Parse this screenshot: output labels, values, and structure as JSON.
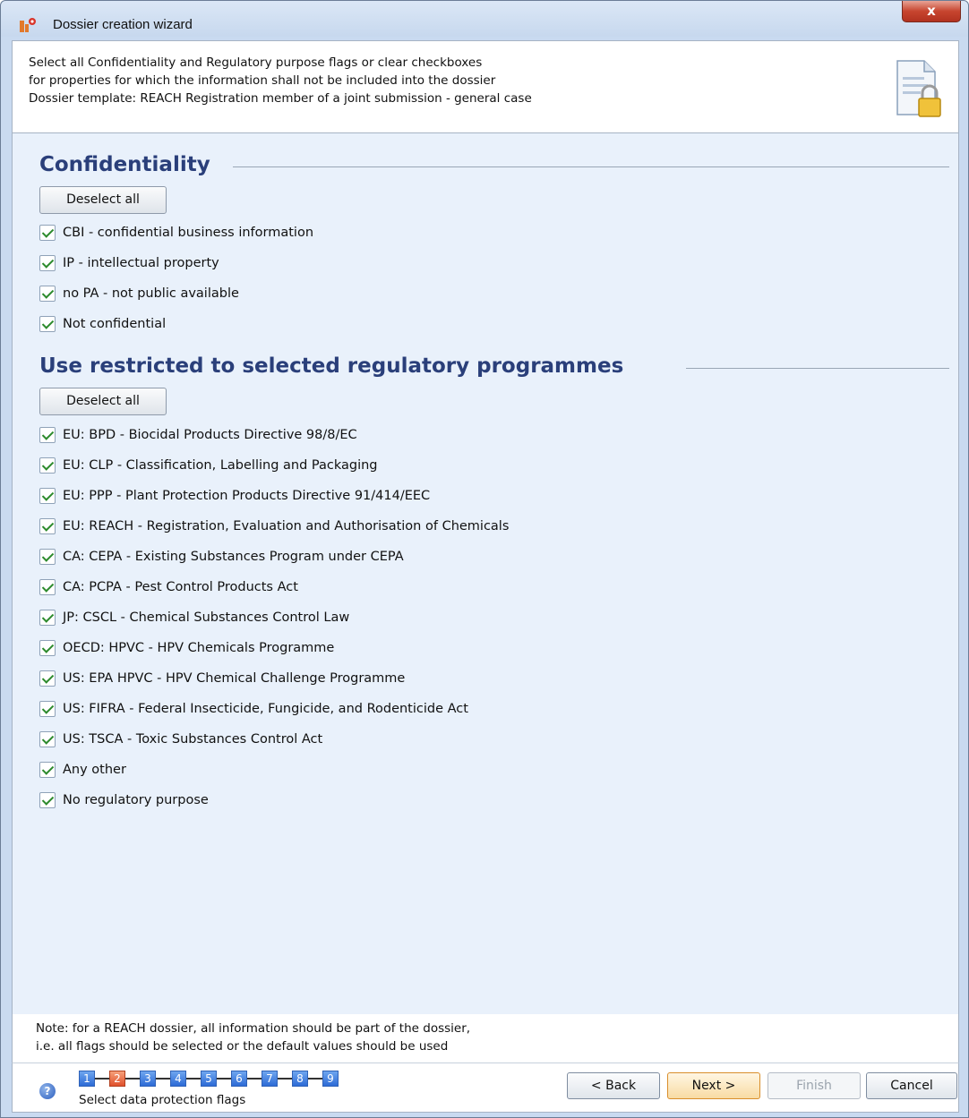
{
  "window": {
    "title": "Dossier creation wizard",
    "close_label": "x"
  },
  "header": {
    "lines": [
      "Select all Confidentiality and Regulatory purpose flags or clear checkboxes",
      "for properties for which the information shall not be included into the dossier",
      "Dossier template: REACH Registration member of a joint submission - general case"
    ],
    "icon": "document-lock-icon"
  },
  "confidentiality": {
    "heading": "Confidentiality",
    "deselect_label": "Deselect all",
    "items": [
      {
        "label": "CBI - confidential business information",
        "checked": true
      },
      {
        "label": "IP - intellectual property",
        "checked": true
      },
      {
        "label": "no PA - not public available",
        "checked": true
      },
      {
        "label": "Not confidential",
        "checked": true
      }
    ]
  },
  "regulatory": {
    "heading": "Use restricted to selected regulatory programmes",
    "deselect_label": "Deselect all",
    "items": [
      {
        "label": "EU: BPD - Biocidal Products Directive 98/8/EC",
        "checked": true
      },
      {
        "label": "EU: CLP - Classification, Labelling and Packaging",
        "checked": true
      },
      {
        "label": "EU: PPP - Plant Protection Products Directive 91/414/EEC",
        "checked": true
      },
      {
        "label": "EU: REACH - Registration, Evaluation and Authorisation of Chemicals",
        "checked": true
      },
      {
        "label": "CA: CEPA - Existing Substances Program under CEPA",
        "checked": true
      },
      {
        "label": "CA: PCPA - Pest Control Products Act",
        "checked": true
      },
      {
        "label": "JP: CSCL - Chemical Substances Control Law",
        "checked": true
      },
      {
        "label": "OECD: HPVC - HPV Chemicals Programme",
        "checked": true
      },
      {
        "label": "US: EPA HPVC - HPV Chemical Challenge Programme",
        "checked": true
      },
      {
        "label": "US: FIFRA - Federal Insecticide, Fungicide, and Rodenticide Act",
        "checked": true
      },
      {
        "label": "US: TSCA - Toxic Substances Control Act",
        "checked": true
      },
      {
        "label": "Any other",
        "checked": true
      },
      {
        "label": "No regulatory purpose",
        "checked": true
      }
    ]
  },
  "note": {
    "lines": [
      "Note: for a REACH dossier, all information should be part of the dossier,",
      "i.e. all flags should be selected or the default values should be used"
    ]
  },
  "footer": {
    "steps": [
      "1",
      "2",
      "3",
      "4",
      "5",
      "6",
      "7",
      "8",
      "9"
    ],
    "current_step": 2,
    "step_caption": "Select data protection flags",
    "buttons": {
      "back": "< Back",
      "next": "Next >",
      "finish": "Finish",
      "cancel": "Cancel"
    }
  },
  "colors": {
    "heading": "#2a3f7a",
    "panel_bg": "#e9f1fb",
    "check": "#2c8a2c",
    "current_step": "#e0512c",
    "step": "#2d6bd6"
  }
}
